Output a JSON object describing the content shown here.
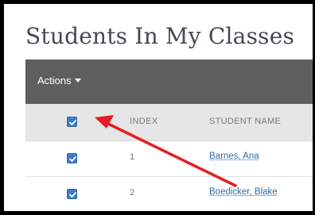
{
  "page": {
    "title": "Students In My Classes"
  },
  "toolbar": {
    "actions_label": "Actions"
  },
  "table": {
    "columns": {
      "index": "INDEX",
      "student_name": "STUDENT NAME"
    },
    "select_all_checked": true,
    "rows": [
      {
        "checked": true,
        "index": "1",
        "student_name": "Barnes, Ana"
      },
      {
        "checked": true,
        "index": "2",
        "student_name": "Boedicker, Blake"
      }
    ]
  },
  "colors": {
    "toolbar_bg": "#5e5e5e",
    "header_bg": "#e6e6e6",
    "checkbox_blue": "#3b7cc4",
    "link_blue": "#2e6da4",
    "annotation_arrow": "#e31e24"
  }
}
